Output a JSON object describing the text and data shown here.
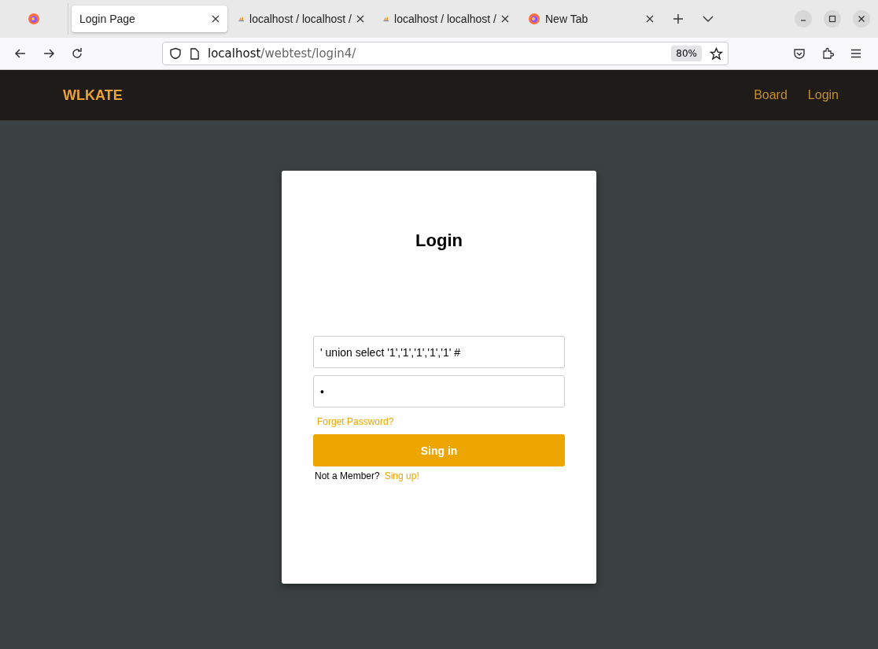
{
  "browser": {
    "tabs": [
      {
        "title": "Login Page",
        "kind": "plain",
        "selected": true
      },
      {
        "title": "localhost / localhost /",
        "kind": "admin",
        "selected": false
      },
      {
        "title": "localhost / localhost /",
        "kind": "admin",
        "selected": false
      },
      {
        "title": "New Tab",
        "kind": "newtab",
        "selected": false
      }
    ],
    "address": {
      "host": "localhost",
      "path": "/webtest/login4/"
    },
    "zoom": "80%"
  },
  "navbar": {
    "brand": "WLKATE",
    "links": [
      "Board",
      "Login"
    ]
  },
  "login": {
    "title": "Login",
    "username": {
      "value": "' union select '1','1','1','1','1' #"
    },
    "password": {
      "value": "•"
    },
    "forgot_link": "Forget Password?",
    "submit": "Sing in",
    "signup_prompt": "Not a Member?",
    "signup_link": "Sing up!"
  }
}
